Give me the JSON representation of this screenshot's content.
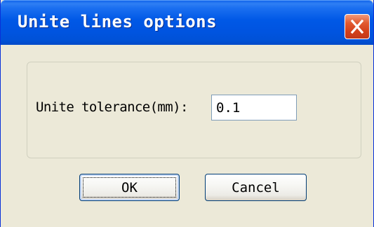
{
  "window": {
    "title": "Unite lines options",
    "close_icon": "close-x-icon",
    "accent_color": "#0058e6",
    "close_color": "#d3401a"
  },
  "form": {
    "tolerance_label": "Unite tolerance(mm):",
    "tolerance_value": "0.1"
  },
  "buttons": {
    "ok_label": "OK",
    "cancel_label": "Cancel"
  }
}
